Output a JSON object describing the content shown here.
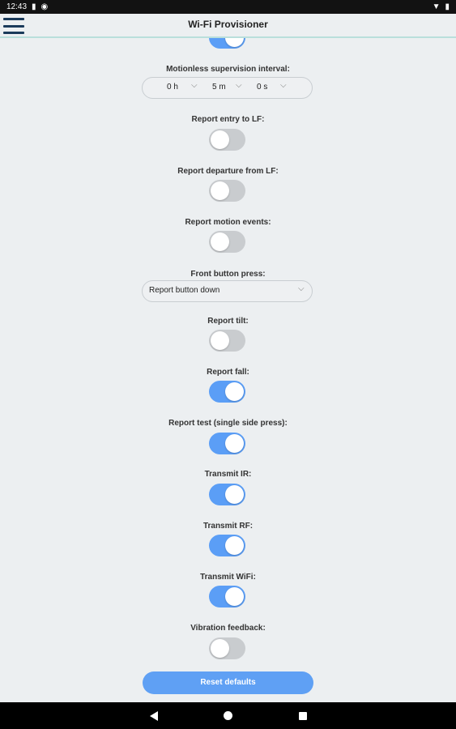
{
  "status_bar": {
    "time": "12:43",
    "icons_left": [
      "sd-card-icon",
      "cast-icon"
    ],
    "icons_right": [
      "wifi-icon",
      "battery-icon"
    ]
  },
  "app_bar": {
    "title": "Wi-Fi Provisioner",
    "menu_icon": "hamburger-menu-icon"
  },
  "settings": {
    "top_toggle_state": true,
    "motionless_interval": {
      "label": "Motionless supervision interval:",
      "hours": "0 h",
      "minutes": "5 m",
      "seconds": "0 s"
    },
    "report_entry_lf": {
      "label": "Report entry to LF:",
      "on": false
    },
    "report_departure_lf": {
      "label": "Report departure from LF:",
      "on": false
    },
    "report_motion": {
      "label": "Report motion events:",
      "on": false
    },
    "front_button": {
      "label": "Front button press:",
      "value": "Report button down"
    },
    "report_tilt": {
      "label": "Report tilt:",
      "on": false
    },
    "report_fall": {
      "label": "Report fall:",
      "on": true
    },
    "report_test": {
      "label": "Report test (single side press):",
      "on": true
    },
    "transmit_ir": {
      "label": "Transmit IR:",
      "on": true
    },
    "transmit_rf": {
      "label": "Transmit RF:",
      "on": true
    },
    "transmit_wifi": {
      "label": "Transmit WiFi:",
      "on": true
    },
    "vibration": {
      "label": "Vibration feedback:",
      "on": false
    }
  },
  "reset_button": {
    "label": "Reset defaults"
  },
  "colors": {
    "toggle_on": "#5b9ef6",
    "toggle_off": "#c9cccf",
    "accent_line": "#b9dfdb"
  }
}
